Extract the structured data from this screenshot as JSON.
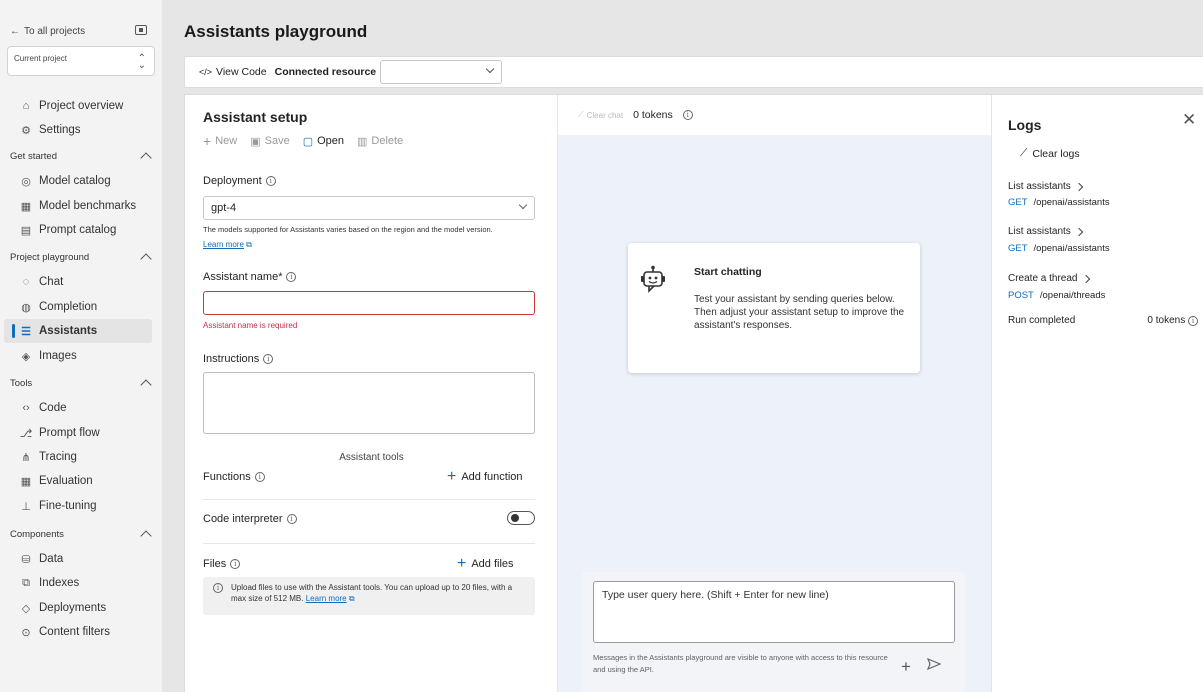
{
  "sidebar": {
    "back_label": "To all projects",
    "project_select": "Current project",
    "items": [
      {
        "label": "Project overview",
        "icon": "home-icon"
      },
      {
        "label": "Settings",
        "icon": "gear-icon"
      }
    ],
    "sections": [
      {
        "title": "Get started",
        "items": [
          "Model catalog",
          "Model benchmarks",
          "Prompt catalog"
        ]
      },
      {
        "title": "Project playground",
        "items": [
          "Chat",
          "Completion",
          "Assistants",
          "Images"
        ]
      },
      {
        "title": "Tools",
        "items": [
          "Code",
          "Prompt flow",
          "Tracing",
          "Evaluation",
          "Fine-tuning"
        ]
      },
      {
        "title": "Components",
        "items": [
          "Data",
          "Indexes",
          "Deployments",
          "Content filters"
        ]
      }
    ],
    "active_item": "Assistants"
  },
  "page": {
    "title": "Assistants playground"
  },
  "toolbar": {
    "view_code": "View Code",
    "connected_resource": "Connected resource",
    "connected_resource_value": ""
  },
  "setup": {
    "title": "Assistant setup",
    "actions": {
      "new": "New",
      "save": "Save",
      "open": "Open",
      "delete": "Delete"
    },
    "deployment_label": "Deployment",
    "deployment_value": "gpt-4",
    "deployment_hint": "The models supported for Assistants varies based on the region and the model version.",
    "learn_more": "Learn more",
    "name_label": "Assistant name*",
    "name_value": "",
    "name_error": "Assistant name is required",
    "instructions_label": "Instructions",
    "instructions_value": "",
    "tools_title": "Assistant tools",
    "functions_label": "Functions",
    "add_function": "Add function",
    "code_interpreter_label": "Code interpreter",
    "code_interpreter_on": false,
    "files_label": "Files",
    "add_files": "Add files",
    "files_note": "Upload files to use with the Assistant tools. You can upload up to 20 files, with a max size of 512 MB.",
    "files_learn_more": "Learn more"
  },
  "chat": {
    "clear_chat": "Clear chat",
    "tokens": "0 tokens",
    "start_title": "Start chatting",
    "start_desc": "Test your assistant by sending queries below. Then adjust your assistant setup to improve the assistant's responses.",
    "input_placeholder": "Type user query here. (Shift + Enter for new line)",
    "note": "Messages in the Assistants playground are visible to anyone with access to this resource and using the API."
  },
  "logs": {
    "title": "Logs",
    "clear": "Clear logs",
    "entries": [
      {
        "title": "List assistants",
        "method": "GET",
        "path": "/openai/assistants"
      },
      {
        "title": "List assistants",
        "method": "GET",
        "path": "/openai/assistants"
      },
      {
        "title": "Create a thread",
        "method": "POST",
        "path": "/openai/threads"
      }
    ],
    "run_label": "Run completed",
    "run_tokens": "0 tokens"
  },
  "colors": {
    "accent": "#0f6cbd",
    "error": "#d13438",
    "chat_bg": "#edf2fa"
  }
}
